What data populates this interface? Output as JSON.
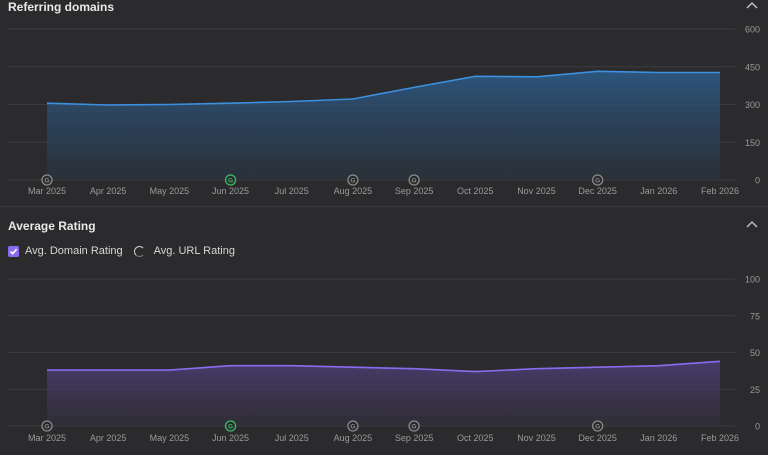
{
  "sections": {
    "referring": {
      "title": "Referring domains"
    },
    "rating": {
      "title": "Average Rating"
    }
  },
  "legend": {
    "domain_rating": "Avg. Domain Rating",
    "url_rating": "Avg. URL Rating"
  },
  "colors": {
    "background": "#2b2b2d",
    "grid": "#3c3c3f",
    "blue_line": "#3d8fe0",
    "purple_line": "#8b6cf0",
    "marker_gray": "#8a8a8a",
    "marker_green": "#3dbb6a",
    "axis_text": "#9a9a9a"
  },
  "chart_data": [
    {
      "type": "area",
      "categories": [
        "Mar 2025",
        "Apr 2025",
        "May 2025",
        "Jun 2025",
        "Jul 2025",
        "Aug 2025",
        "Sep 2025",
        "Oct 2025",
        "Nov 2025",
        "Dec 2025",
        "Jan 2026",
        "Feb 2026"
      ],
      "series": [
        {
          "values": [
            305,
            298,
            300,
            305,
            312,
            322,
            368,
            412,
            410,
            432,
            427,
            427
          ]
        }
      ],
      "yticks": [
        0,
        150,
        300,
        450,
        600
      ],
      "ylim": [
        0,
        600
      ],
      "markers": [
        {
          "category": "Mar 2025",
          "label": "G",
          "color": "gray"
        },
        {
          "category": "Jun 2025",
          "label": "G",
          "color": "green"
        },
        {
          "category": "Aug 2025",
          "label": "G",
          "color": "gray"
        },
        {
          "category": "Sep 2025",
          "label": "G",
          "color": "gray"
        },
        {
          "category": "Dec 2025",
          "label": "G",
          "color": "gray"
        }
      ],
      "grid": true
    },
    {
      "type": "area",
      "categories": [
        "Mar 2025",
        "Apr 2025",
        "May 2025",
        "Jun 2025",
        "Jul 2025",
        "Aug 2025",
        "Sep 2025",
        "Oct 2025",
        "Nov 2025",
        "Dec 2025",
        "Jan 2026",
        "Feb 2026"
      ],
      "series": [
        {
          "values": [
            38,
            38,
            38,
            41,
            41,
            40,
            39,
            37,
            39,
            40,
            41,
            44
          ]
        }
      ],
      "yticks": [
        0,
        25,
        50,
        75,
        100
      ],
      "ylim": [
        0,
        100
      ],
      "markers": [
        {
          "category": "Mar 2025",
          "label": "G",
          "color": "gray"
        },
        {
          "category": "Jun 2025",
          "label": "G",
          "color": "green"
        },
        {
          "category": "Aug 2025",
          "label": "G",
          "color": "gray"
        },
        {
          "category": "Sep 2025",
          "label": "G",
          "color": "gray"
        },
        {
          "category": "Dec 2025",
          "label": "G",
          "color": "gray"
        }
      ],
      "grid": true
    }
  ]
}
